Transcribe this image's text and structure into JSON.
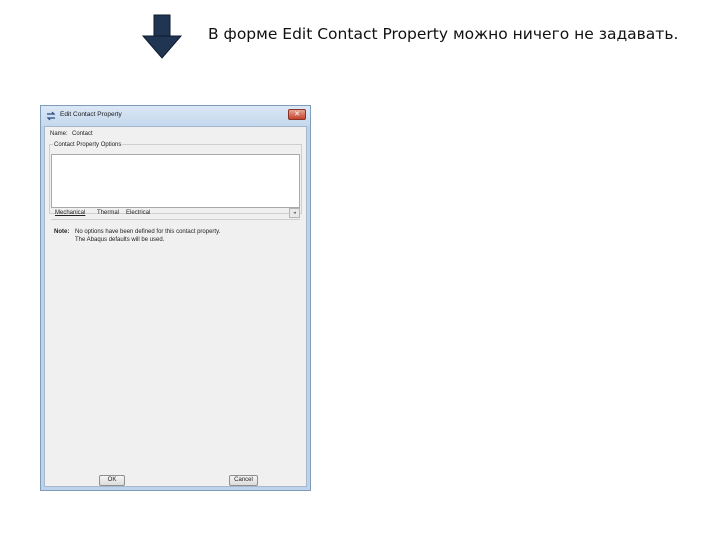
{
  "slide": {
    "caption": "В форме Edit Contact Property можно ничего не задавать.",
    "arrow_icon": "down-arrow-icon"
  },
  "dialog": {
    "title": "Edit Contact Property",
    "close_glyph": "✕",
    "name_label": "Name:",
    "name_value": "Contact",
    "group_label": "Contact Property Options",
    "tabs": [
      "Mechanical",
      "Thermal",
      "Electrical"
    ],
    "tab_scroll_glyph": "◂",
    "note_label": "Note:",
    "note_lines": [
      "No options have been defined for this contact property.",
      "The Abaqus defaults will be used."
    ],
    "ok_label": "OK",
    "cancel_label": "Cancel"
  }
}
